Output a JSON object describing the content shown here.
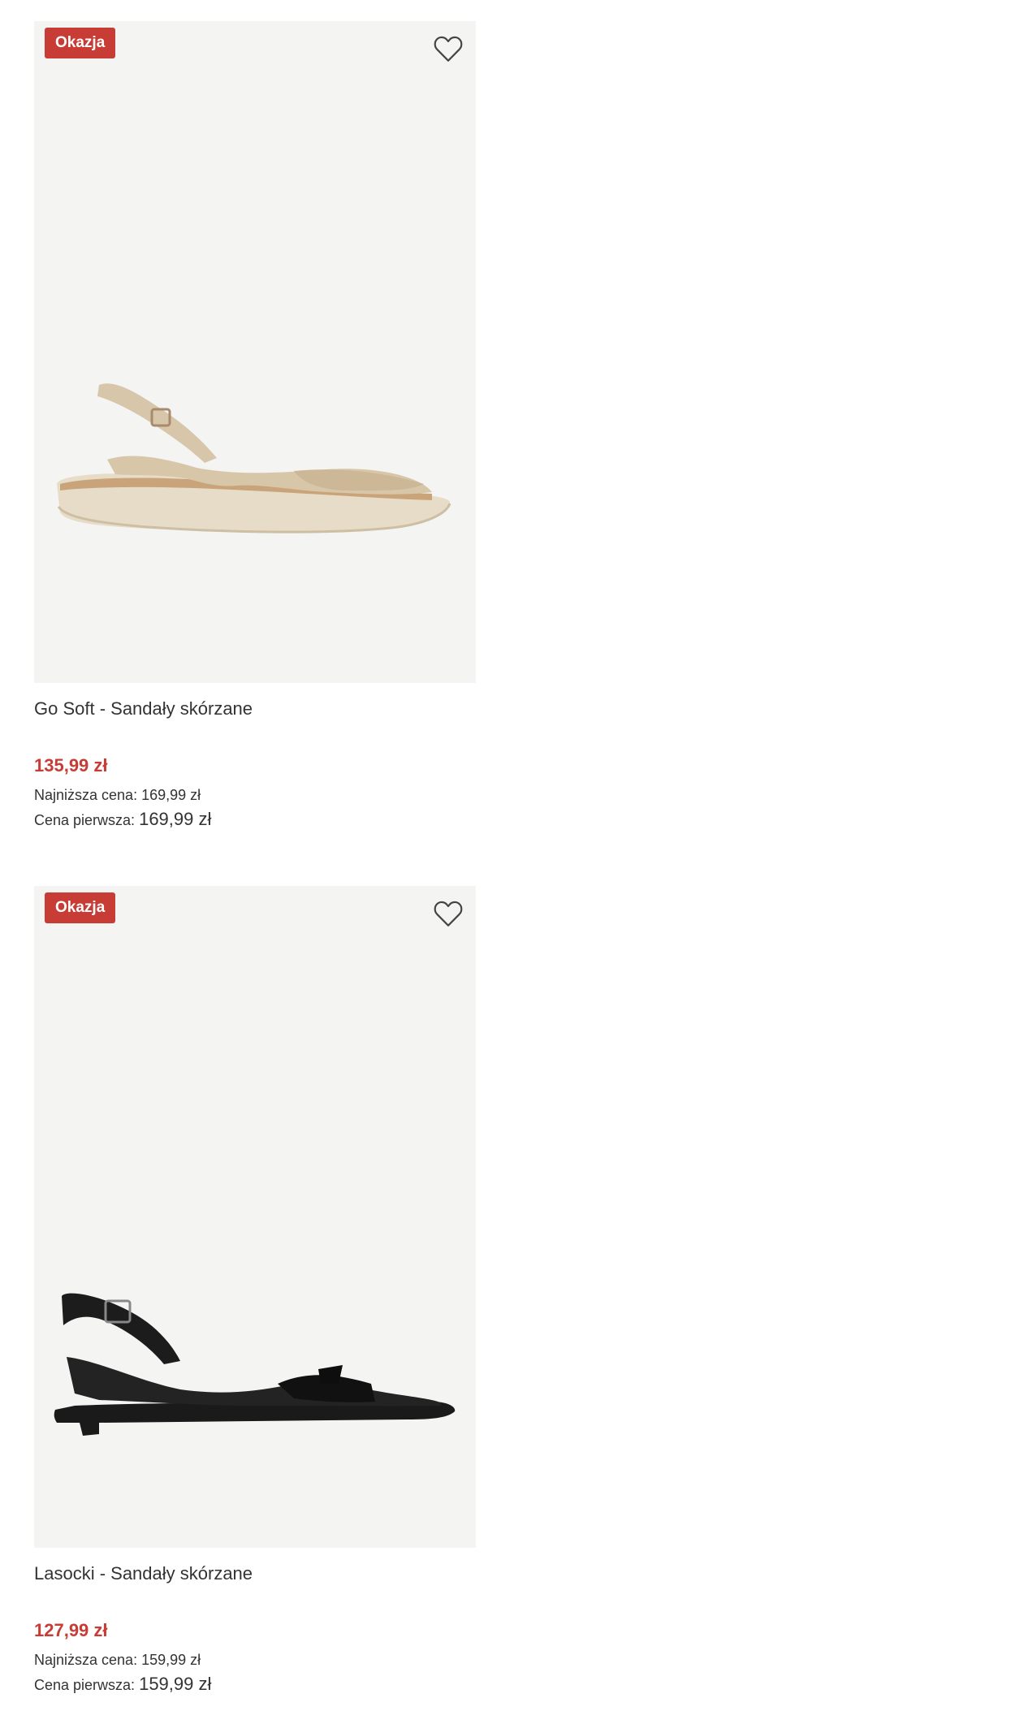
{
  "products": [
    {
      "badge": "Okazja",
      "title": "Go Soft - Sandały skórzane",
      "price": "135,99 zł",
      "lowest_label": "Najniższa cena:",
      "lowest_value": "169,99 zł",
      "first_label": "Cena pierwsza:",
      "first_value": "169,99 zł",
      "image_color": "#d9cbb4"
    },
    {
      "badge": "Okazja",
      "title": "Lasocki - Sandały skórzane",
      "price": "127,99 zł",
      "lowest_label": "Najniższa cena:",
      "lowest_value": "159,99 zł",
      "first_label": "Cena pierwsza:",
      "first_value": "159,99 zł",
      "image_color": "#1c1c1c"
    }
  ],
  "icons": {
    "favorite": "heart-outline-icon"
  },
  "colors": {
    "accent": "#c83c36",
    "image_bg": "#f4f4f3"
  }
}
